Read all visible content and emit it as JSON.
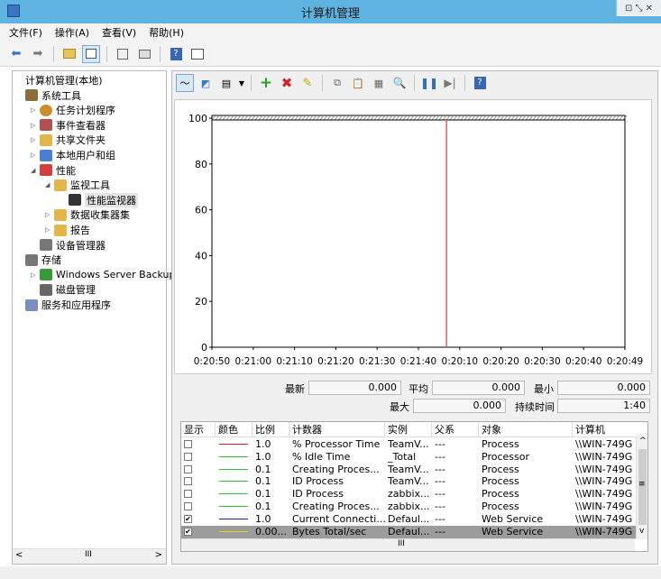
{
  "window": {
    "title": "计算机管理",
    "controls": "⊡ ⤡ ✕"
  },
  "menu": [
    "文件(F)",
    "操作(A)",
    "查看(V)",
    "帮助(H)"
  ],
  "tree": [
    {
      "label": "计算机管理(本地)",
      "level": 0,
      "icon": "computer-icon",
      "exp": ""
    },
    {
      "label": "系统工具",
      "level": 0,
      "icon": "tools-icon",
      "exp": ""
    },
    {
      "label": "任务计划程序",
      "level": 1,
      "icon": "clock-icon",
      "exp": "▷"
    },
    {
      "label": "事件查看器",
      "level": 1,
      "icon": "event-icon",
      "exp": "▷"
    },
    {
      "label": "共享文件夹",
      "level": 1,
      "icon": "folder-icon",
      "exp": "▷"
    },
    {
      "label": "本地用户和组",
      "level": 1,
      "icon": "users-icon",
      "exp": "▷"
    },
    {
      "label": "性能",
      "level": 1,
      "icon": "perf-icon",
      "exp": "◢"
    },
    {
      "label": "监视工具",
      "level": 2,
      "icon": "monitor-folder-icon",
      "exp": "◢"
    },
    {
      "label": "性能监视器",
      "level": 3,
      "icon": "chart-icon",
      "exp": ""
    },
    {
      "label": "数据收集器集",
      "level": 2,
      "icon": "collector-icon",
      "exp": "▷"
    },
    {
      "label": "报告",
      "level": 2,
      "icon": "report-icon",
      "exp": "▷"
    },
    {
      "label": "设备管理器",
      "level": 1,
      "icon": "device-icon",
      "exp": ""
    },
    {
      "label": "存储",
      "level": 0,
      "icon": "storage-icon",
      "exp": ""
    },
    {
      "label": "Windows Server Backup",
      "level": 1,
      "icon": "backup-icon",
      "exp": "▷"
    },
    {
      "label": "磁盘管理",
      "level": 1,
      "icon": "disk-icon",
      "exp": ""
    },
    {
      "label": "服务和应用程序",
      "level": 0,
      "icon": "services-icon",
      "exp": ""
    }
  ],
  "chart_data": {
    "type": "line",
    "ylim": [
      0,
      100
    ],
    "yticks": [
      "100",
      "80",
      "60",
      "40",
      "20",
      "0"
    ],
    "xticks": [
      "0:20:50",
      "0:21:00",
      "0:21:10",
      "0:21:20",
      "0:21:30",
      "0:21:40",
      "0:20:10",
      "0:20:20",
      "0:20:30",
      "0:20:40",
      "0:20:49"
    ],
    "cursor_after_tick": "0:21:40",
    "cursor_color": "#e06060"
  },
  "stats": {
    "last_label": "最新",
    "last_value": "0.000",
    "avg_label": "平均",
    "avg_value": "0.000",
    "min_label": "最小",
    "min_value": "0.000",
    "max_label": "最大",
    "max_value": "0.000",
    "dur_label": "持续时间",
    "dur_value": "1:40"
  },
  "counters": {
    "headers": [
      "显示",
      "颜色",
      "比例",
      "计数器",
      "实例",
      "父系",
      "对象",
      "计算机"
    ],
    "rows": [
      {
        "show": false,
        "color": "#e02020",
        "scale": "1.0",
        "counter": "% Processor Time",
        "instance": "TeamV...",
        "parent": "---",
        "object": "Process",
        "computer": "\\\\WIN-749G",
        "selected": false
      },
      {
        "show": false,
        "color": "#30c030",
        "scale": "1.0",
        "counter": "% Idle Time",
        "instance": "_Total",
        "parent": "---",
        "object": "Processor",
        "computer": "\\\\WIN-749G",
        "selected": false
      },
      {
        "show": false,
        "color": "#30c030",
        "scale": "0.1",
        "counter": "Creating Proces...",
        "instance": "TeamV...",
        "parent": "---",
        "object": "Process",
        "computer": "\\\\WIN-749G",
        "selected": false
      },
      {
        "show": false,
        "color": "#30c030",
        "scale": "0.1",
        "counter": "ID Process",
        "instance": "TeamV...",
        "parent": "---",
        "object": "Process",
        "computer": "\\\\WIN-749G",
        "selected": false
      },
      {
        "show": false,
        "color": "#30c030",
        "scale": "0.1",
        "counter": "ID Process",
        "instance": "zabbix...",
        "parent": "---",
        "object": "Process",
        "computer": "\\\\WIN-749G",
        "selected": false
      },
      {
        "show": false,
        "color": "#30c030",
        "scale": "0.1",
        "counter": "Creating Proces...",
        "instance": "zabbix...",
        "parent": "---",
        "object": "Process",
        "computer": "\\\\WIN-749G",
        "selected": false
      },
      {
        "show": true,
        "color": "#202090",
        "scale": "1.0",
        "counter": "Current Connecti...",
        "instance": "Defaul...",
        "parent": "---",
        "object": "Web Service",
        "computer": "\\\\WIN-749G",
        "selected": false
      },
      {
        "show": true,
        "color": "#e0d020",
        "scale": "0.00...",
        "counter": "Bytes Total/sec",
        "instance": "Defaul...",
        "parent": "---",
        "object": "Web Service",
        "computer": "\\\\WIN-749G",
        "selected": true
      }
    ]
  },
  "scroll": {
    "grip": "III",
    "grip_v": "≡",
    "arrow_left": "<",
    "arrow_right": ">",
    "arrow_up": "^",
    "arrow_down": "v"
  }
}
